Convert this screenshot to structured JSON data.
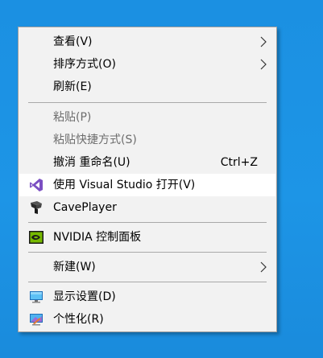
{
  "menu": {
    "items": [
      {
        "label": "查看(V)",
        "submenu": true
      },
      {
        "label": "排序方式(O)",
        "submenu": true
      },
      {
        "label": "刷新(E)"
      },
      {
        "label": "粘贴(P)",
        "disabled": true
      },
      {
        "label": "粘贴快捷方式(S)",
        "disabled": true
      },
      {
        "label": "撤消 重命名(U)",
        "shortcut": "Ctrl+Z"
      },
      {
        "label": "使用 Visual Studio 打开(V)",
        "icon": "visual-studio-icon",
        "highlighted": true
      },
      {
        "label": "CavePlayer",
        "icon": "caveplayer-icon"
      },
      {
        "label": "NVIDIA 控制面板",
        "icon": "nvidia-icon"
      },
      {
        "label": "新建(W)",
        "submenu": true
      },
      {
        "label": "显示设置(D)",
        "icon": "display-settings-icon"
      },
      {
        "label": "个性化(R)",
        "icon": "personalize-icon"
      }
    ]
  },
  "colors": {
    "desktop": "#1a8fe0",
    "menu_background": "#f2f2f2",
    "hover_background": "#ffffff",
    "disabled_text": "#6d6d6d",
    "separator": "#a9a9a9",
    "visual_studio_purple": "#7b4fc2",
    "nvidia_green": "#76b900"
  }
}
